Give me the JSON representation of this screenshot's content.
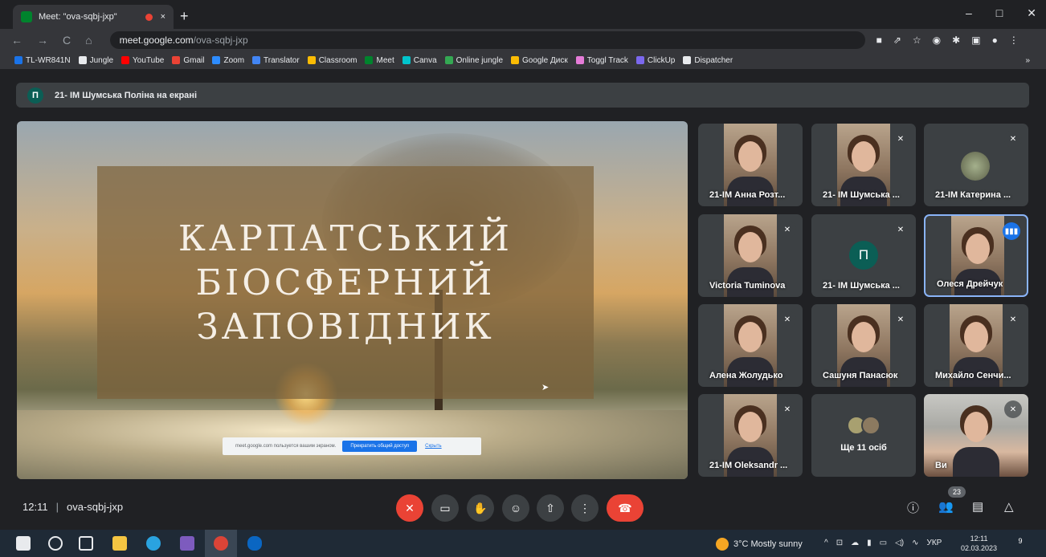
{
  "browser": {
    "tab_title": "Meet: \"ova-sqbj-jxp\"",
    "close_glyph": "×",
    "new_tab_glyph": "+",
    "url_host": "meet.google.com",
    "url_path": "/ova-sqbj-jxp",
    "nav": {
      "back": "←",
      "forward": "→",
      "reload": "C",
      "home": "⌂"
    },
    "window_controls": {
      "minimize": "–",
      "maximize": "□",
      "close": "✕"
    },
    "bookmarks": [
      {
        "label": "TL-WR841N",
        "color": "#1a73e8"
      },
      {
        "label": "Jungle",
        "color": "#e8eaed"
      },
      {
        "label": "YouTube",
        "color": "#ff0000"
      },
      {
        "label": "Gmail",
        "color": "#ea4335"
      },
      {
        "label": "Zoom",
        "color": "#2d8cff"
      },
      {
        "label": "Translator",
        "color": "#4285f4"
      },
      {
        "label": "Classroom",
        "color": "#fbbc04"
      },
      {
        "label": "Meet",
        "color": "#00832d"
      },
      {
        "label": "Canva",
        "color": "#00c4cc"
      },
      {
        "label": "Online jungle",
        "color": "#34a853"
      },
      {
        "label": "Google Диск",
        "color": "#fbbc04"
      },
      {
        "label": "Toggl Track",
        "color": "#e57cd8"
      },
      {
        "label": "ClickUp",
        "color": "#7b68ee"
      },
      {
        "label": "Dispatcher",
        "color": "#e8eaed"
      }
    ],
    "bookmarks_more": "»"
  },
  "meet": {
    "presenting_banner": {
      "avatar_letter": "П",
      "text": "21- IM Шумська Поліна на екрані"
    },
    "slide": {
      "title_lines": [
        "КАРПАТСЬКИЙ",
        "БІОСФЕРНИЙ",
        "ЗАПОВІДНИК"
      ]
    },
    "share_bar": {
      "text": "meet.google.com пользуется вашим экраном.",
      "stop_label": "Прекратить общий доступ",
      "hide_label": "Скрыть"
    },
    "participants": [
      {
        "name": "21-IM Анна Розт...",
        "muted": false,
        "type": "video"
      },
      {
        "name": "21- IM Шумська ...",
        "muted": true,
        "type": "video"
      },
      {
        "name": "21-IM Катерина ...",
        "muted": true,
        "type": "small-avatar"
      },
      {
        "name": "Victoria Tuminova",
        "muted": true,
        "type": "video"
      },
      {
        "name": "21- IM Шумська ...",
        "muted": true,
        "type": "letter",
        "letter": "П"
      },
      {
        "name": "Олеся Дрейчук",
        "muted": false,
        "speaking": true,
        "type": "video"
      },
      {
        "name": "Алена Жолудько",
        "muted": true,
        "type": "video"
      },
      {
        "name": "Сашуня Панасюк",
        "muted": true,
        "type": "video"
      },
      {
        "name": "Михайло Сенчи...",
        "muted": true,
        "type": "video"
      },
      {
        "name": "21-IM Oleksandr ...",
        "muted": true,
        "type": "video"
      },
      {
        "name": "Ще 11 осіб",
        "type": "more"
      },
      {
        "name": "Ви",
        "muted": true,
        "type": "video-wide"
      }
    ],
    "mute_glyph": "✕",
    "speak_glyph": "▮▮▮",
    "bottom": {
      "time": "12:11",
      "separator": "|",
      "meeting_code": "ova-sqbj-jxp",
      "people_count": "23",
      "controls": {
        "mic_glyph": "✕",
        "camera_glyph": "▭",
        "hand_glyph": "✋",
        "emoji_glyph": "☺",
        "present_glyph": "⇧",
        "more_glyph": "⋮",
        "hangup_glyph": "☎",
        "info_glyph": "ⓘ",
        "people_glyph": "👥",
        "chat_glyph": "▤",
        "activities_glyph": "△"
      }
    }
  },
  "taskbar": {
    "weather": "3°C  Mostly sunny",
    "tray": [
      "^",
      "⊡",
      "☁",
      "▮",
      "▭",
      "◁)",
      "∿",
      "УКР"
    ],
    "clock_time": "12:11",
    "clock_date": "02.03.2023",
    "notification_count": "9"
  }
}
